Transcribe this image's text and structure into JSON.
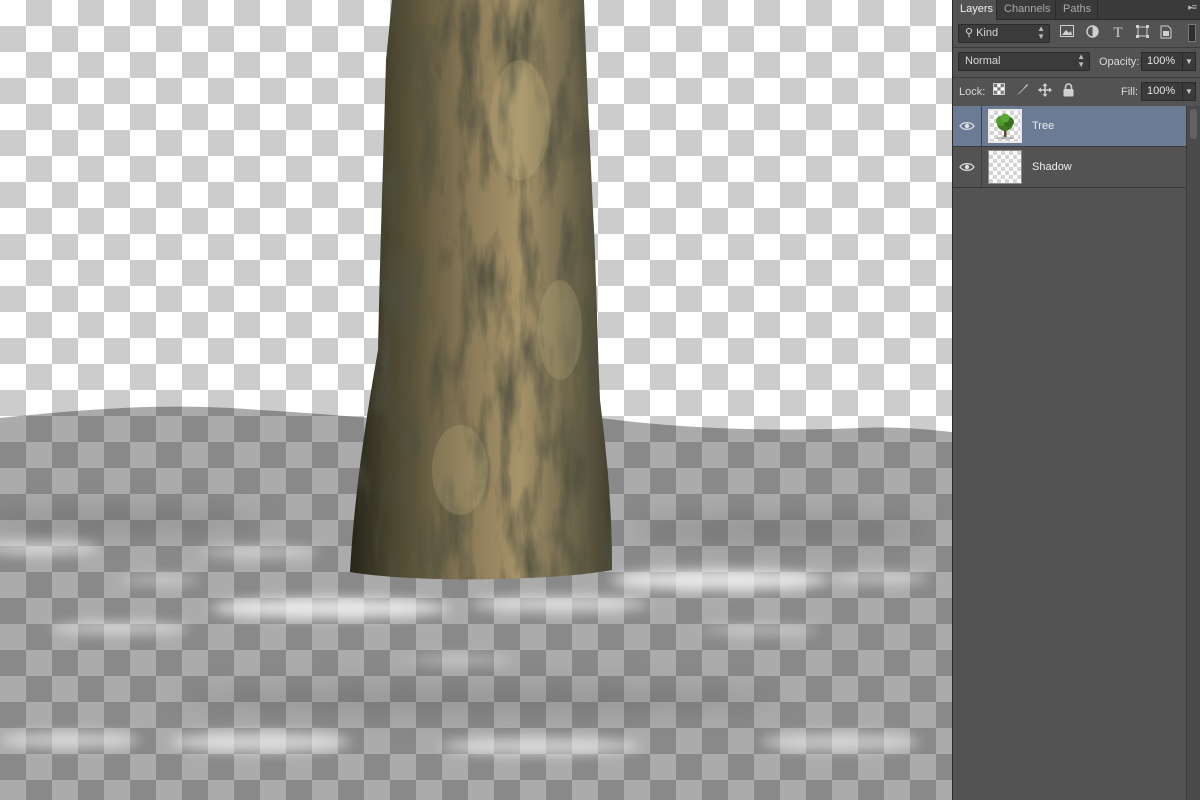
{
  "panel": {
    "tabs": [
      {
        "label": "Layers",
        "active": true
      },
      {
        "label": "Channels",
        "active": false
      },
      {
        "label": "Paths",
        "active": false
      }
    ],
    "filter": {
      "kind_label": "Kind",
      "icons": [
        "pixel-filter-icon",
        "adjustment-filter-icon",
        "type-filter-icon",
        "shape-filter-icon",
        "smart-object-filter-icon"
      ]
    },
    "blend": {
      "mode": "Normal",
      "opacity_label": "Opacity:",
      "opacity_value": "100%"
    },
    "lock": {
      "label": "Lock:",
      "icons": [
        "lock-transparent-pixels-icon",
        "lock-image-pixels-icon",
        "lock-position-icon",
        "lock-all-icon"
      ],
      "fill_label": "Fill:",
      "fill_value": "100%"
    },
    "layers": [
      {
        "name": "Tree",
        "visible": true,
        "selected": true,
        "thumbnail": "tree-thumbnail"
      },
      {
        "name": "Shadow",
        "visible": true,
        "selected": false,
        "thumbnail": "transparent-thumbnail"
      }
    ]
  },
  "colors": {
    "panel_bg": "#535353",
    "selected_layer": "#6b7b94",
    "tab_bar": "#3a3a3a",
    "checker_light": "#ffffff",
    "checker_dark": "#cccccc"
  }
}
